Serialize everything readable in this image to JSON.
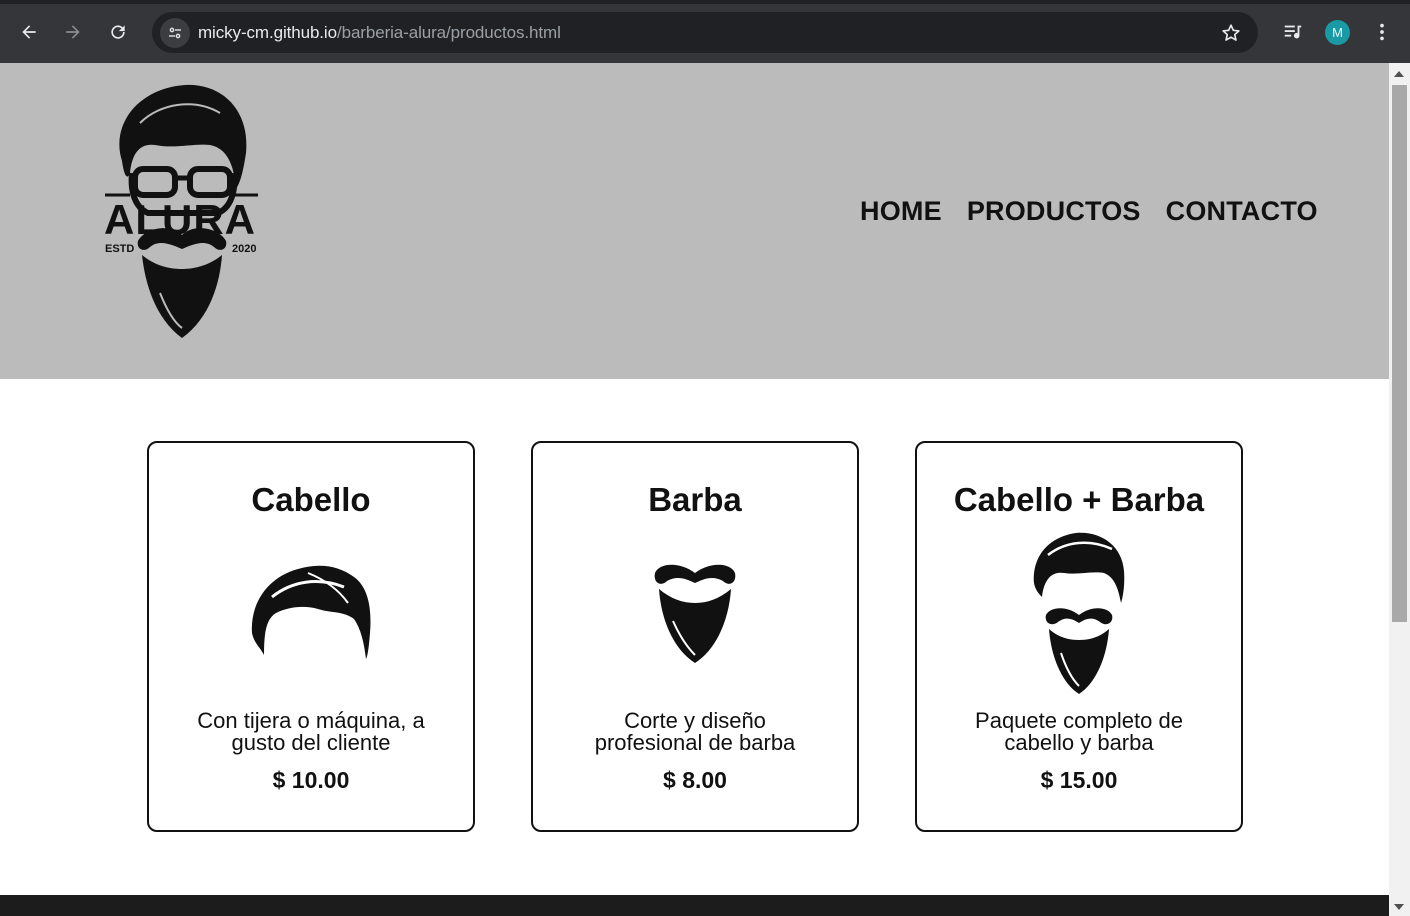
{
  "browser": {
    "url_host": "micky-cm.github.io",
    "url_path": "/barberia-alura/productos.html",
    "avatar_initial": "M",
    "accent_avatar": "#1a9aa4"
  },
  "site": {
    "logo_text": "ALURA",
    "logo_estd": "ESTD",
    "logo_year": "2020",
    "nav": [
      "HOME",
      "PRODUCTOS",
      "CONTACTO"
    ],
    "header_color": "#bbbbbb"
  },
  "products": [
    {
      "title": "Cabello",
      "icon": "hair-icon",
      "description": "Con tijera o máquina, a gusto del cliente",
      "price": "$ 10.00"
    },
    {
      "title": "Barba",
      "icon": "beard-icon",
      "description": "Corte y diseño profesional de barba",
      "price": "$ 8.00"
    },
    {
      "title": "Cabello + Barba",
      "icon": "hair-and-beard-icon",
      "description": "Paquete completo de cabello y barba",
      "price": "$ 15.00"
    }
  ]
}
